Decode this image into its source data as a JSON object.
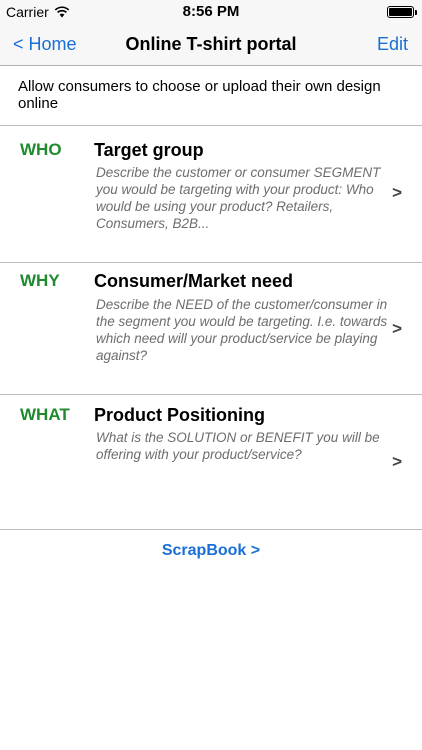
{
  "status_bar": {
    "carrier": "Carrier",
    "time": "8:56 PM"
  },
  "nav": {
    "back_label": "< Home",
    "title": "Online T-shirt portal",
    "edit_label": "Edit"
  },
  "description": "Allow consumers to choose or upload their own design online",
  "sections": [
    {
      "tag": "WHO",
      "title": "Target group",
      "description": "Describe the customer or consumer SEGMENT you would be targeting with your product: Who would be using your product? Retailers, Consumers, B2B...",
      "chevron": ">"
    },
    {
      "tag": "WHY",
      "title": "Consumer/Market need",
      "description": "Describe the NEED of the customer/consumer in the segment you would be targeting. I.e. towards which need will your product/service be playing against?",
      "chevron": ">"
    },
    {
      "tag": "WHAT",
      "title": "Product Positioning",
      "description": "What is the SOLUTION or BENEFIT you will be offering with your product/service?",
      "chevron": ">"
    }
  ],
  "scrapbook_label": "ScrapBook >",
  "colors": {
    "accent_blue": "#1a6fd6",
    "tag_green": "#1f8a2e",
    "desc_gray": "#6d6d6d"
  }
}
